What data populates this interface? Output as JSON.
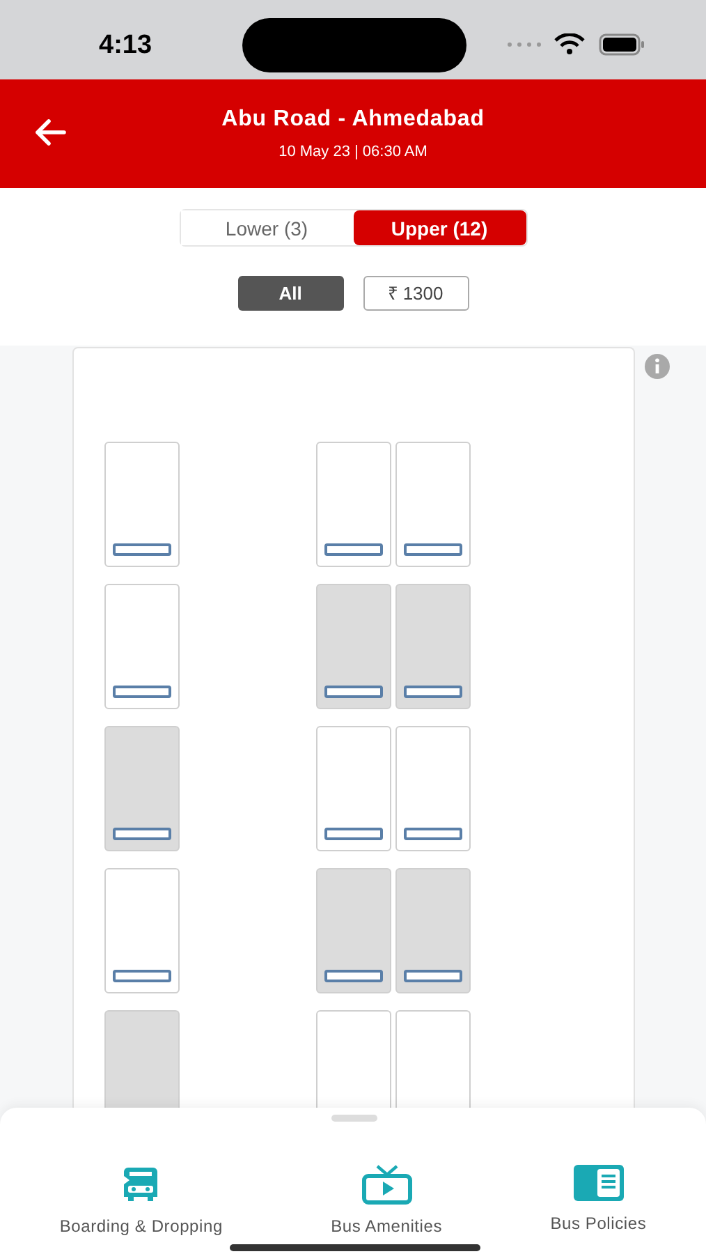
{
  "status_bar": {
    "time": "4:13"
  },
  "header": {
    "title": "Abu Road - Ahmedabad",
    "subtitle": "10 May 23 | 06:30 AM"
  },
  "deck_tabs": [
    {
      "label": "Lower (3)",
      "selected": false
    },
    {
      "label": "Upper (12)",
      "selected": true
    }
  ],
  "price_filters": [
    {
      "label": "All",
      "selected": true
    },
    {
      "label": "₹ 1300",
      "selected": false
    }
  ],
  "seat_rows": [
    {
      "left": [
        {
          "booked": false
        }
      ],
      "right": [
        {
          "booked": false
        },
        {
          "booked": false
        }
      ]
    },
    {
      "left": [
        {
          "booked": false
        }
      ],
      "right": [
        {
          "booked": true
        },
        {
          "booked": true
        }
      ]
    },
    {
      "left": [
        {
          "booked": true
        }
      ],
      "right": [
        {
          "booked": false
        },
        {
          "booked": false
        }
      ]
    },
    {
      "left": [
        {
          "booked": false
        }
      ],
      "right": [
        {
          "booked": true
        },
        {
          "booked": true
        }
      ]
    },
    {
      "left": [
        {
          "booked": true
        }
      ],
      "right": [
        {
          "booked": false
        },
        {
          "booked": false
        }
      ],
      "cut_off": true
    }
  ],
  "bottom_tabs": [
    {
      "label": "Boarding & Dropping",
      "kind": "bus"
    },
    {
      "label": "Bus Amenities",
      "kind": "tv"
    },
    {
      "label": "Bus Policies",
      "kind": "policy"
    }
  ]
}
